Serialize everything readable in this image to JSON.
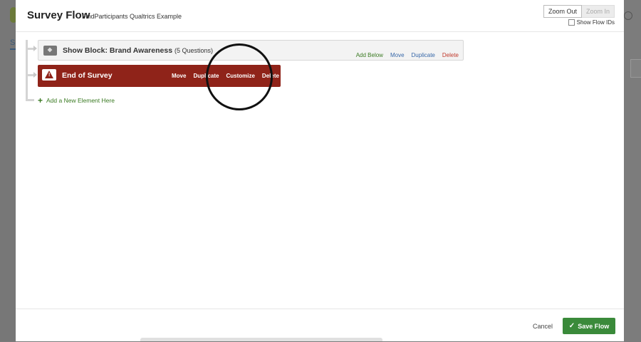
{
  "modal": {
    "title": "Survey Flow",
    "subtitle": "FindParticipants Qualtrics Example",
    "zoom_out": "Zoom Out",
    "zoom_in": "Zoom In",
    "show_flow_ids": "Show Flow IDs"
  },
  "flow": {
    "show_block": {
      "title": "Show Block: Brand Awareness",
      "count": "(5 Questions)",
      "actions": {
        "add_below": "Add Below",
        "move": "Move",
        "duplicate": "Duplicate",
        "delete": "Delete"
      }
    },
    "end_of_survey": {
      "title": "End of Survey",
      "actions": {
        "move": "Move",
        "duplicate": "Duplicate",
        "customize": "Customize",
        "delete": "Delete"
      }
    },
    "add_element": "Add a New Element Here"
  },
  "footer": {
    "cancel": "Cancel",
    "save": "Save Flow"
  },
  "background": {
    "nav_letter": "S"
  },
  "colors": {
    "end_block": "#8f2319",
    "save_button": "#3a8a3a",
    "action_green": "#3a7a22",
    "action_blue": "#3667a8",
    "action_red": "#c0392b"
  }
}
